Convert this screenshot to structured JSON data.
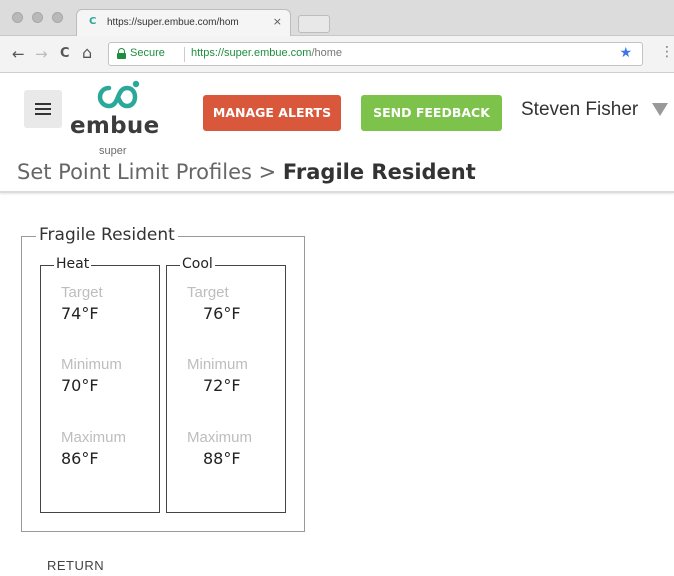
{
  "browser": {
    "tab_title": "https://super.embue.com/hom",
    "tab_favicon": "embue-favicon",
    "tab_close": "×",
    "nav_back": "←",
    "nav_forward": "→",
    "nav_reload": "C",
    "nav_home": "⌂",
    "secure_label": "Secure",
    "url_host": "https://super.embue.com",
    "url_path": "/home",
    "bookmark": "★",
    "menu": "⋮"
  },
  "header": {
    "logo_text": "embue",
    "logo_sub": "super",
    "manage_alerts_label": "MANAGE ALERTS",
    "send_feedback_label": "SEND FEEDBACK",
    "user_name": "Steven Fisher",
    "colors": {
      "manage_alerts": "#d9583b",
      "send_feedback": "#7cc24b",
      "brand": "#2aa89a"
    }
  },
  "breadcrumb": {
    "parent": "Set Point Limit Profiles",
    "separator": " > ",
    "current": "Fragile Resident"
  },
  "profile": {
    "name": "Fragile Resident",
    "heat": {
      "title": "Heat",
      "target_label": "Target",
      "target_value": "74°F",
      "minimum_label": "Minimum",
      "minimum_value": "70°F",
      "maximum_label": "Maximum",
      "maximum_value": "86°F"
    },
    "cool": {
      "title": "Cool",
      "target_label": "Target",
      "target_value": "76°F",
      "minimum_label": "Minimum",
      "minimum_value": "72°F",
      "maximum_label": "Maximum",
      "maximum_value": "88°F"
    }
  },
  "footer": {
    "return_label": "RETURN"
  }
}
